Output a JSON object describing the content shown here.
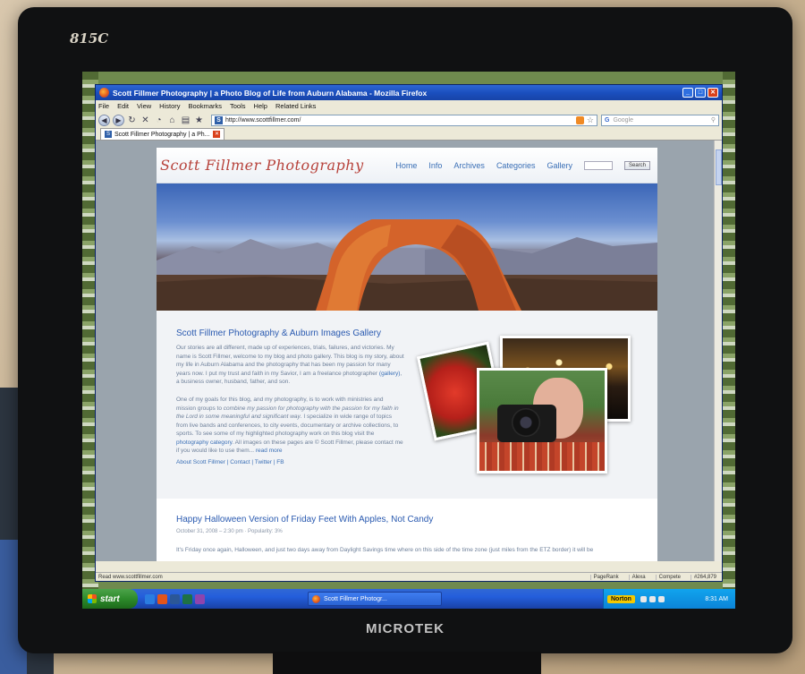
{
  "monitor": {
    "model": "815C",
    "brand": "MICROTEK"
  },
  "browser": {
    "window_title": "Scott Fillmer Photography | a Photo Blog of Life from Auburn Alabama - Mozilla Firefox",
    "menu": [
      "File",
      "Edit",
      "View",
      "History",
      "Bookmarks",
      "Tools",
      "Help",
      "Related Links"
    ],
    "url": "http://www.scottfillmer.com/",
    "search_placeholder": "Google",
    "tab_label": "Scott Fillmer Photography | a Ph..."
  },
  "site": {
    "title": "Scott Fillmer Photography",
    "nav": [
      "Home",
      "Info",
      "Archives",
      "Categories",
      "Gallery"
    ],
    "search_button": "Search",
    "intro": {
      "heading": "Scott Fillmer Photography & Auburn Images Gallery",
      "p1_a": "Our stories are all different, made up of experiences, trials, failures, and victories. My name is Scott Fillmer, welcome to my blog and photo gallery. This blog is my story, about my life in Auburn Alabama and the photography that has been my passion for many years now. I put my trust and faith in my Savior, I am a freelance photographer ",
      "p1_link": "(gallery)",
      "p1_b": ", a business owner, husband, father, and son.",
      "p2_a": "One of my goals for this blog, and my photography, is to work with ministries and mission groups to ",
      "p2_em": "combine my passion for photography with the passion for my faith in the Lord in some meaningful and significant way",
      "p2_b": ". I specialize in wide range of topics from live bands and conferences, to city events, documentary or archive collections, to sports. To see some of my highlighted photography work on this blog visit the ",
      "p2_link": "photography category",
      "p2_c": ". All images on these pages are © Scott Fillmer, please contact me if you would like to use them... ",
      "p2_more": "read more",
      "about_links": "About Scott Fillmer | Contact | Twitter | FB"
    },
    "post": {
      "title": "Happy Halloween Version of Friday Feet With Apples, Not Candy",
      "meta": "October 31, 2008 – 2:30 pm · Popularity: 3%",
      "excerpt": "It's Friday once again, Halloween, and just two days away from Daylight Savings time where on this side of the time zone (just miles from the ETZ border) it will be"
    }
  },
  "statusbar": {
    "left": "Read www.scottfillmer.com",
    "items": [
      "PageRank",
      "Alexa",
      "Compete",
      "#264,879"
    ]
  },
  "taskbar": {
    "start": "start",
    "task": "Scott Fillmer Photogr...",
    "norton": "Norton",
    "clock": "8:31 AM"
  },
  "colors": {
    "title_bar": "#1b4fbe",
    "site_title": "#b7423b",
    "link": "#3a6fb6",
    "taskbar": "#245edb"
  }
}
